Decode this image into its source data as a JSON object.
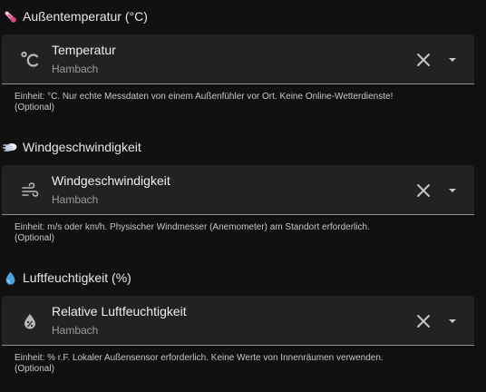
{
  "sections": [
    {
      "title": "Außentemperatur (°C)",
      "emoji_icon": "thermometer-icon",
      "field": {
        "icon": "celsius-icon",
        "value": "Temperatur",
        "secondary": "Hambach"
      },
      "helper": "Einheit: °C. Nur echte Messdaten von einem Außenfühler vor Ort. Keine Online-Wetterdienste!",
      "optional": "(Optional)"
    },
    {
      "title": "Windgeschwindigkeit",
      "emoji_icon": "wind-icon",
      "field": {
        "icon": "weather-windy-icon",
        "value": "Windgeschwindigkeit",
        "secondary": "Hambach"
      },
      "helper": "Einheit: m/s oder km/h. Physischer Windmesser (Anemometer) am Standort erforderlich.",
      "optional": "(Optional)"
    },
    {
      "title": "Luftfeuchtigkeit (%)",
      "emoji_icon": "droplet-icon",
      "field": {
        "icon": "water-percent-icon",
        "value": "Relative Luftfeuchtigkeit",
        "secondary": "Hambach"
      },
      "helper": "Einheit: % r.F. Lokaler Außensensor erforderlich. Keine Werte von Innenräumen verwenden.",
      "optional": "(Optional)"
    }
  ],
  "colors": {
    "background": "#111111",
    "field_background": "#222222",
    "underline": "#8e8e8e",
    "icon": "#b8b8b8",
    "droplet": "#4aa3df",
    "thermometer": "#e98ab6"
  }
}
